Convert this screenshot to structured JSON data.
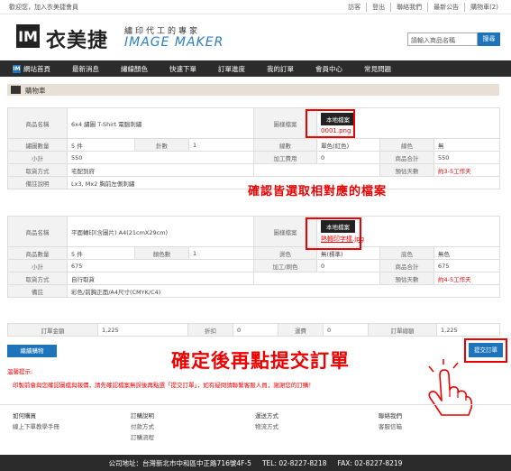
{
  "topbar": {
    "welcome": "歡迎您，加入衣美捷會員",
    "links": [
      "訪客",
      "登出",
      "聯絡我們",
      "最新公告",
      "購物車(2)"
    ]
  },
  "brand": {
    "logo_mark": "IM",
    "name_cn": "衣美捷",
    "slogan": "繡印代工的專家",
    "name_en": "IMAGE MAKER"
  },
  "search": {
    "placeholder": "請輸入商品名稱",
    "button": "搜尋"
  },
  "nav": {
    "home_icon": "IM",
    "items": [
      "網站首頁",
      "最新消息",
      "繡線顏色",
      "快速下單",
      "訂單進度",
      "我的訂單",
      "會員中心",
      "常見問題"
    ]
  },
  "cart": {
    "title": "購物車"
  },
  "order1": {
    "labels": {
      "product": "商品名稱",
      "design": "圖樣檔案",
      "qty": "繡圖數量",
      "stitch": "針數",
      "color": "線數",
      "thread": "線色",
      "subtotal": "小計",
      "process": "加工費用",
      "itemtotal": "商品合計",
      "pickup": "取貨方式",
      "days": "預估天數",
      "note": "備註說明"
    },
    "product": "6x4 繡圖 T-Shirt 電腦刺繡",
    "file_button": "本地檔案",
    "file_name": "0001.png",
    "qty": "5 件",
    "stitch": "1",
    "color": "單色(紅色)",
    "thread": "無",
    "subtotal": "550",
    "process": "0",
    "itemtotal": "550",
    "pickup": "宅配到府",
    "days": "約3-5工作天",
    "note": "Lx3, Mx2 胸前左側刺繡"
  },
  "order2": {
    "labels": {
      "product": "商品名稱",
      "design": "圖樣檔案",
      "qty": "商品數量",
      "stitch": "顏色數",
      "color": "燙色",
      "thread": "底色",
      "subtotal": "小計",
      "process": "加工/刷色",
      "itemtotal": "商品合計",
      "pickup": "取貨方式",
      "days": "預估天數",
      "note": "備註"
    },
    "product": "平面轉印(含圖片) A4(21cmX29cm)",
    "file_button": "本地檔案",
    "file_name": "熱轉印字樣.jpg",
    "qty": "5 件",
    "stitch": "1",
    "color": "無(標準)",
    "thread": "無色",
    "subtotal": "675",
    "process": "0",
    "itemtotal": "675",
    "pickup": "自行取貨",
    "days": "約4-5工作天",
    "note": "彩色/前胸正面/A4尺寸(CMYK/C4)"
  },
  "totals": {
    "labels": [
      "訂單金額",
      "折扣",
      "運費",
      "訂單總額"
    ],
    "values": [
      "1,225",
      "0",
      "0",
      "1,225"
    ]
  },
  "buttons": {
    "continue": "繼續購物",
    "submit": "提交訂單"
  },
  "annotations": {
    "select_file": "確認皆選取相對應的檔案",
    "submit_after": "確定後再點提交訂單"
  },
  "notice": {
    "title": "溫馨提示:",
    "text": "印製前會與您確認圖檔與報價，請先確認檔案無誤後再點選「提交訂單」，如有疑問請聯繫客服人員，謝謝您的訂購！"
  },
  "footer": {
    "columns": [
      {
        "heading": "如何購買",
        "items": [
          "線上下單教學手冊"
        ]
      },
      {
        "heading": "訂購說明",
        "items": [
          "付款方式",
          "訂購流程"
        ]
      },
      {
        "heading": "運送方式",
        "items": [
          "物流方式"
        ]
      },
      {
        "heading": "聯絡我們",
        "items": [
          "客服信箱"
        ]
      }
    ],
    "address": "公司地址：台灣新北市中和區中正路716號4F-5",
    "tel": "TEL: 02-8227-8218",
    "fax": "FAX: 02-8227-8219"
  },
  "colors": {
    "accent": "#1e74bb",
    "alert": "#e00000",
    "nav_bg": "#2b2b2b",
    "cart_bar": "#e8e0d4"
  }
}
